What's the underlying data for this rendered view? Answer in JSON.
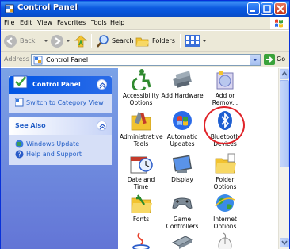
{
  "window": {
    "title": "Control Panel"
  },
  "menu": [
    "File",
    "Edit",
    "View",
    "Favorites",
    "Tools",
    "Help"
  ],
  "toolbar": {
    "back": "Back",
    "search": "Search",
    "folders": "Folders"
  },
  "address": {
    "label": "Address",
    "value": "Control Panel",
    "go": "Go"
  },
  "left": {
    "control_panel": {
      "title": "Control Panel",
      "link": "Switch to Category View"
    },
    "see_also": {
      "title": "See Also",
      "links": [
        "Windows Update",
        "Help and Support"
      ]
    }
  },
  "items": [
    {
      "label": "Accessibility Options"
    },
    {
      "label": "Add Hardware"
    },
    {
      "label": "Add or Remov..."
    },
    {
      "label": "Administrative Tools"
    },
    {
      "label": "Automatic Updates"
    },
    {
      "label": "Bluetooth Devices"
    },
    {
      "label": "Date and Time"
    },
    {
      "label": "Display"
    },
    {
      "label": "Folder Options"
    },
    {
      "label": "Fonts"
    },
    {
      "label": "Game Controllers"
    },
    {
      "label": "Internet Options"
    }
  ],
  "colors": {
    "highlight": "#e0242a",
    "title_bar": "#0a5fe0",
    "link": "#215dc6"
  }
}
